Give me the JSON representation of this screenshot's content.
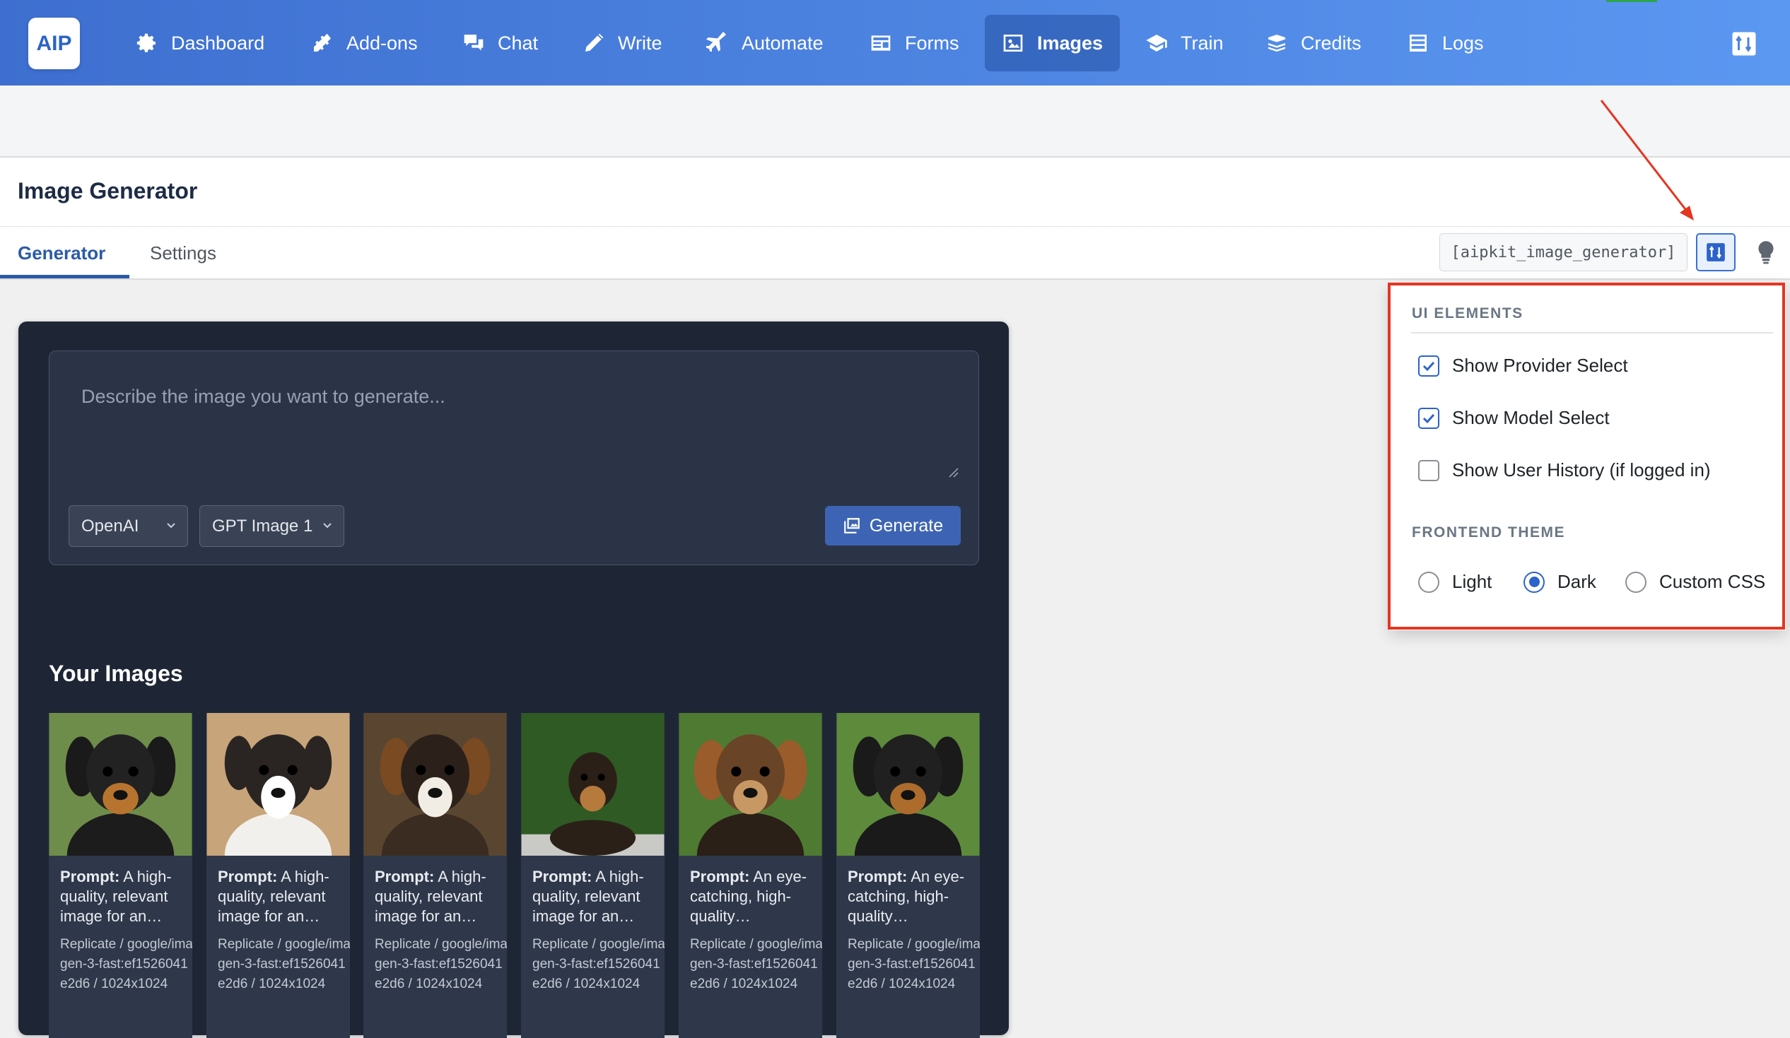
{
  "app": {
    "logo": "AIP"
  },
  "nav": {
    "items": [
      {
        "label": "Dashboard",
        "icon": "gear-icon"
      },
      {
        "label": "Add-ons",
        "icon": "plug-icon"
      },
      {
        "label": "Chat",
        "icon": "chat-icon"
      },
      {
        "label": "Write",
        "icon": "pencil-icon"
      },
      {
        "label": "Automate",
        "icon": "plane-icon"
      },
      {
        "label": "Forms",
        "icon": "form-icon"
      },
      {
        "label": "Images",
        "icon": "image-icon",
        "active": true
      },
      {
        "label": "Train",
        "icon": "graduation-icon"
      },
      {
        "label": "Credits",
        "icon": "coins-icon"
      },
      {
        "label": "Logs",
        "icon": "list-icon"
      }
    ]
  },
  "page": {
    "title": "Image Generator"
  },
  "tabs": [
    {
      "label": "Generator",
      "active": true
    },
    {
      "label": "Settings"
    }
  ],
  "shortcode": "[aipkit_image_generator]",
  "config_panel": {
    "ui_elements_heading": "UI ELEMENTS",
    "options": [
      {
        "label": "Show Provider Select",
        "checked": true
      },
      {
        "label": "Show Model Select",
        "checked": true
      },
      {
        "label": "Show User History (if logged in)",
        "checked": false
      }
    ],
    "theme_heading": "FRONTEND THEME",
    "themes": [
      {
        "label": "Light",
        "selected": false
      },
      {
        "label": "Dark",
        "selected": true
      },
      {
        "label": "Custom CSS",
        "selected": false
      }
    ]
  },
  "generator": {
    "placeholder": "Describe the image you want to generate...",
    "provider": "OpenAI",
    "model": "GPT Image 1",
    "generate_label": "Generate"
  },
  "gallery": {
    "heading": "Your Images",
    "prompt_label": "Prompt:",
    "items": [
      {
        "prompt": "A high-quality, relevant image for an…",
        "meta": "Replicate / google/imagen-3-fast:ef1526041e2d6 / 1024x1024"
      },
      {
        "prompt": "A high-quality, relevant image for an…",
        "meta": "Replicate / google/imagen-3-fast:ef1526041e2d6 / 1024x1024"
      },
      {
        "prompt": "A high-quality, relevant image for an…",
        "meta": "Replicate / google/imagen-3-fast:ef1526041e2d6 / 1024x1024"
      },
      {
        "prompt": "A high-quality, relevant image for an…",
        "meta": "Replicate / google/imagen-3-fast:ef1526041e2d6 / 1024x1024"
      },
      {
        "prompt": "An eye-catching, high-quality…",
        "meta": "Replicate / google/imagen-3-fast:ef1526041e2d6 / 1024x1024"
      },
      {
        "prompt": "An eye-catching, high-quality…",
        "meta": "Replicate / google/imagen-3-fast:ef1526041e2d6 / 1024x1024"
      }
    ]
  },
  "colors": {
    "nav_gradient_start": "#3e6fd0",
    "nav_gradient_end": "#5b98f2",
    "accent": "#2c5aa8",
    "highlight_red": "#e43520",
    "card_bg": "#1e2636"
  }
}
